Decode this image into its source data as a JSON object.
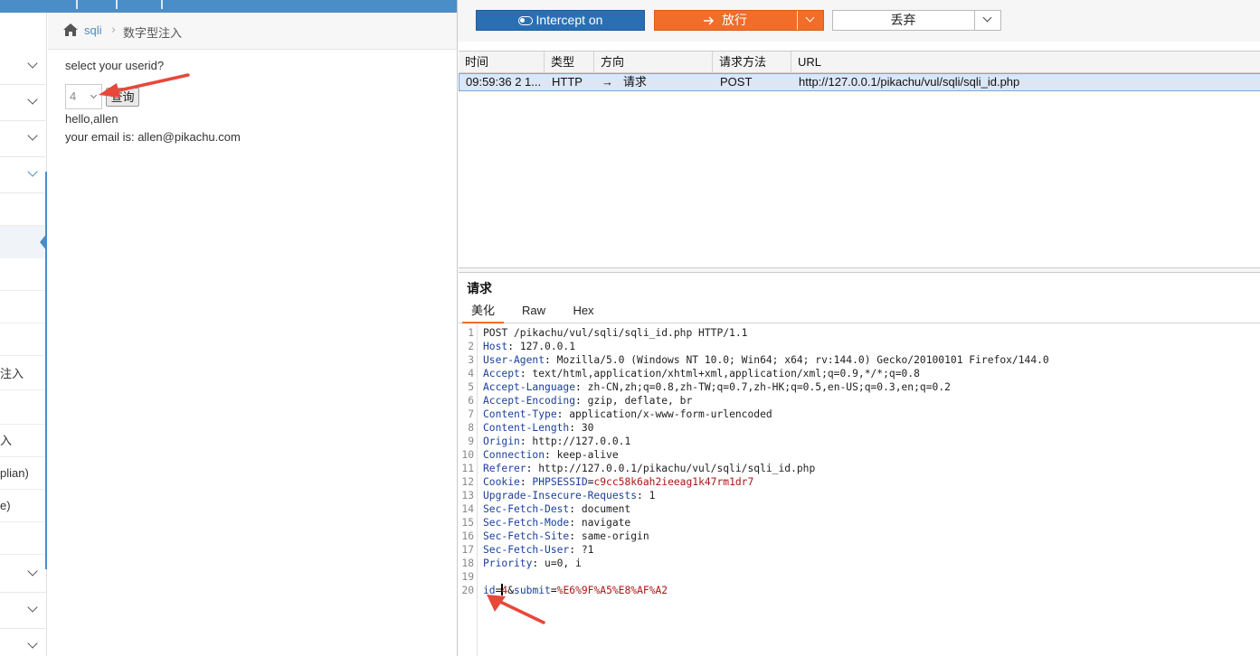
{
  "left_app": {
    "breadcrumb": {
      "link": "sqli",
      "separator": "›",
      "current": "数字型注入"
    },
    "sidebar_fragments": [
      "注入",
      "入",
      "plian)",
      "e)"
    ],
    "content": {
      "prompt": "select your userid?",
      "select_value": "4",
      "query_button": "查询",
      "greeting": "hello,allen",
      "email_line": "your email is: allen@pikachu.com"
    }
  },
  "burp": {
    "toolbar": {
      "intercept_label": "Intercept on",
      "forward_label": "放行",
      "drop_label": "丢弃",
      "intercept_color": "#2a6fb4",
      "forward_color": "#f06d2a"
    },
    "table": {
      "headers": [
        "时间",
        "类型",
        "方向",
        "请求方法",
        "URL"
      ],
      "row": {
        "time": "09:59:36 2 1...",
        "type": "HTTP",
        "direction_arrow": "→",
        "direction": "请求",
        "method": "POST",
        "url": "http://127.0.0.1/pikachu/vul/sqli/sqli_id.php"
      }
    },
    "request_panel": {
      "title": "请求",
      "tabs": [
        "美化",
        "Raw",
        "Hex"
      ],
      "active_tab": "美化"
    },
    "request_lines": [
      {
        "n": "1",
        "name": "",
        "sep": "",
        "value": "POST /pikachu/vul/sqli/sqli_id.php HTTP/1.1"
      },
      {
        "n": "2",
        "name": "Host",
        "sep": ": ",
        "value": "127.0.0.1"
      },
      {
        "n": "3",
        "name": "User-Agent",
        "sep": ": ",
        "value": "Mozilla/5.0 (Windows NT 10.0; Win64; x64; rv:144.0) Gecko/20100101 Firefox/144.0"
      },
      {
        "n": "4",
        "name": "Accept",
        "sep": ": ",
        "value": "text/html,application/xhtml+xml,application/xml;q=0.9,*/*;q=0.8"
      },
      {
        "n": "5",
        "name": "Accept-Language",
        "sep": ": ",
        "value": "zh-CN,zh;q=0.8,zh-TW;q=0.7,zh-HK;q=0.5,en-US;q=0.3,en;q=0.2"
      },
      {
        "n": "6",
        "name": "Accept-Encoding",
        "sep": ": ",
        "value": "gzip, deflate, br"
      },
      {
        "n": "7",
        "name": "Content-Type",
        "sep": ": ",
        "value": "application/x-www-form-urlencoded"
      },
      {
        "n": "8",
        "name": "Content-Length",
        "sep": ": ",
        "value": "30"
      },
      {
        "n": "9",
        "name": "Origin",
        "sep": ": ",
        "value": "http://127.0.0.1"
      },
      {
        "n": "10",
        "name": "Connection",
        "sep": ": ",
        "value": "keep-alive"
      },
      {
        "n": "11",
        "name": "Referer",
        "sep": ": ",
        "value": "http://127.0.0.1/pikachu/vul/sqli/sqli_id.php"
      },
      {
        "n": "12",
        "name": "Cookie",
        "sep": ": ",
        "value": ""
      },
      {
        "n": "13",
        "name": "Upgrade-Insecure-Requests",
        "sep": ": ",
        "value": "1"
      },
      {
        "n": "14",
        "name": "Sec-Fetch-Dest",
        "sep": ": ",
        "value": "document"
      },
      {
        "n": "15",
        "name": "Sec-Fetch-Mode",
        "sep": ": ",
        "value": "navigate"
      },
      {
        "n": "16",
        "name": "Sec-Fetch-Site",
        "sep": ": ",
        "value": "same-origin"
      },
      {
        "n": "17",
        "name": "Sec-Fetch-User",
        "sep": ": ",
        "value": "?1"
      },
      {
        "n": "18",
        "name": "Priority",
        "sep": ": ",
        "value": "u=0, i"
      },
      {
        "n": "19",
        "name": "",
        "sep": "",
        "value": ""
      }
    ],
    "cookie": {
      "name": "PHPSESSID",
      "eq": "=",
      "value": "c9cc58k6ah2ieeag1k47rm1dr7"
    },
    "body": {
      "line_no": "20",
      "p1_name": "id",
      "eq1": "=",
      "p1_value": "4",
      "amp": "&",
      "p2_name": "submit",
      "eq2": "=",
      "p2_value": "%E6%9F%A5%E8%AF%A2"
    }
  }
}
